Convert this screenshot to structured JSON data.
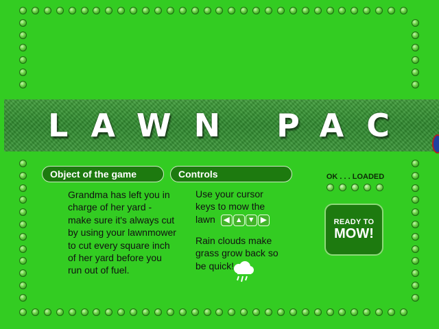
{
  "title": "LAWN PAC",
  "objective": {
    "heading": "Object of the game",
    "text": "Grandma has left you in charge of her yard - make sure it's always cut by using your lawnmower to cut every square inch of her yard before you run out of fuel."
  },
  "controls": {
    "heading": "Controls",
    "line1": "Use your cursor keys to mow the lawn",
    "line2": "Rain clouds make grass grow back so be quick!",
    "arrow_icons": [
      "arrow-left-icon",
      "arrow-up-icon",
      "arrow-down-icon",
      "arrow-right-icon"
    ]
  },
  "loader": {
    "status": "OK . . . LOADED",
    "progress": 1.0
  },
  "start_button": {
    "line1": "READY TO",
    "line2": "MOW!"
  },
  "colors": {
    "background": "#33cc22",
    "panel": "#1d7a0f",
    "text": "#111111"
  }
}
